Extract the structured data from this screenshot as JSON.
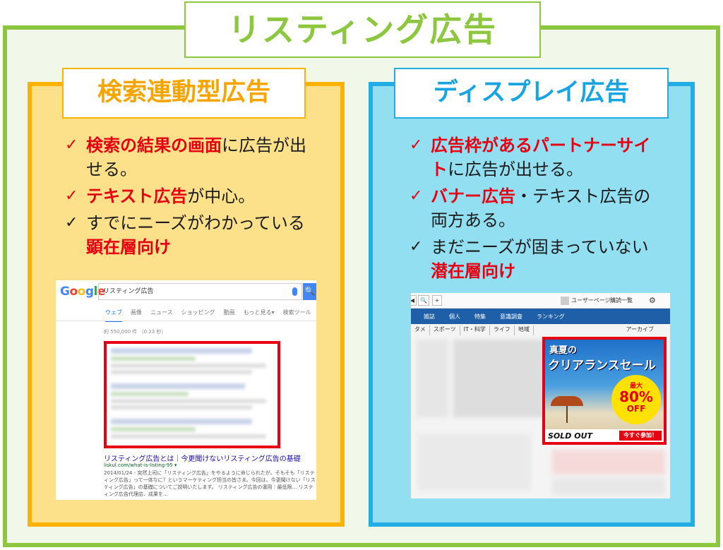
{
  "main_title": "リスティング広告",
  "left": {
    "title": "検索連動型広告",
    "bullets": [
      {
        "highlight": "検索の結果の画面",
        "text": "に広告が出せる。"
      },
      {
        "highlight": "テキスト広告",
        "text": "が中心。"
      },
      {
        "text": "すでにニーズがわかっている",
        "highlight": "顕在層向け"
      }
    ],
    "google": {
      "logo": "Google",
      "query": "リスティング広告",
      "search_btn": "🔍",
      "tabs": [
        "ウェブ",
        "画像",
        "ニュース",
        "ショッピング",
        "動画",
        "もっと見る▾",
        "検索ツール"
      ],
      "result_count": "約 550,000 件 （0.23 秒）",
      "result_title": "リスティング広告とは｜今更聞けないリスティング広告の基礎",
      "result_url": "liskul.com/what-is-listing-95 ▾",
      "result_desc": "2014/01/24 - 突然上司に「リスティング広告」をやるように命じられたが、そもそも「リスティング広告」って一体なに？というマーケティング担当の皆さま。今回は、今更聞けない「リスティング広告」の基礎についてご説明いたします。 リスティング広告の運用｜最低限… リスティング広告代理店、成果を…"
    }
  },
  "right": {
    "title": "ディスプレイ広告",
    "bullets": [
      {
        "highlight": "広告枠があるパートナーサイト",
        "text": "に広告が出せる。"
      },
      {
        "highlight": "バナー広告",
        "text": "・テキスト広告の両方ある。"
      },
      {
        "text": "まだニーズが固まっていない",
        "highlight": "潜在層向け"
      }
    ],
    "display": {
      "top_buttons": [
        "◀",
        "🔍",
        "+"
      ],
      "user": "ユーザーページ",
      "list": "購読一覧",
      "gear": "⚙",
      "nav": [
        "雑誌",
        "個人",
        "特集",
        "意識調査",
        "ランキング"
      ],
      "subnav": [
        "タメ",
        "スポーツ",
        "IT・科学",
        "ライフ",
        "地域"
      ],
      "archive": "アーカイブ",
      "ad": {
        "line1": "真夏の",
        "line2": "クリアランスセール",
        "max": "最大",
        "percent": "80%",
        "off": "OFF",
        "sold": "SOLD OUT",
        "join": "今すぐ参加！"
      }
    }
  }
}
